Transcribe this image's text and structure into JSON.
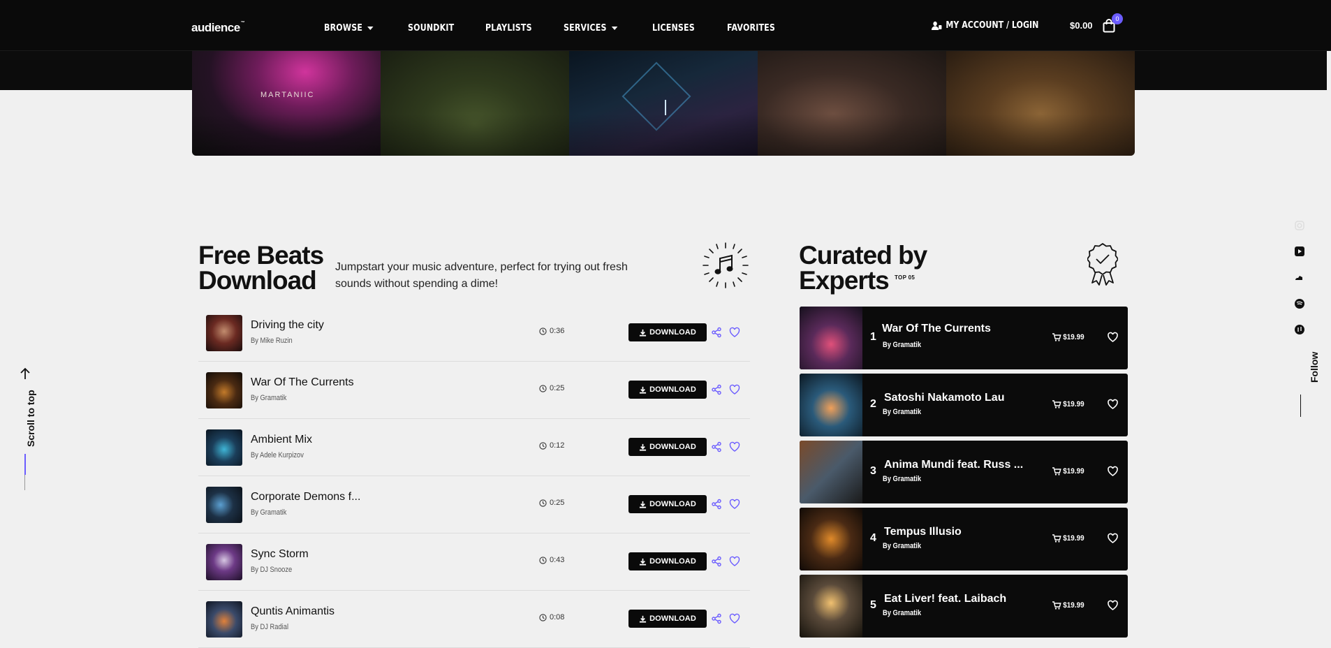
{
  "header": {
    "logo": "audience",
    "logo_tm": "™",
    "nav": [
      "BROWSE",
      "SOUNDKIT",
      "PLAYLISTS",
      "SERVICES",
      "LICENSES",
      "FAVORITES"
    ],
    "account": "MY ACCOUNT / LOGIN",
    "cart_total": "$0.00",
    "cart_count": "0"
  },
  "banner": {
    "label": "MARTANIIC"
  },
  "free_beats": {
    "title_line1": "Free Beats",
    "title_line2": "Download",
    "intro": "Jumpstart your music adventure, perfect for trying out fresh sounds without spending a dime!",
    "download_label": "DOWNLOAD",
    "items": [
      {
        "title": "Driving the city",
        "artist": "By Mike Ruzin",
        "time": "0:36"
      },
      {
        "title": "War Of The Currents",
        "artist": "By Gramatik",
        "time": "0:25"
      },
      {
        "title": "Ambient Mix",
        "artist": "By Adele Kurpizov",
        "time": "0:12"
      },
      {
        "title": "Corporate Demons f...",
        "artist": "By Gramatik",
        "time": "0:25"
      },
      {
        "title": "Sync Storm",
        "artist": "By DJ Snooze",
        "time": "0:43"
      },
      {
        "title": "Quntis Animantis",
        "artist": "By DJ Radial",
        "time": "0:08"
      }
    ]
  },
  "curated": {
    "title_line1": "Curated by",
    "title_line2": "Experts",
    "badge": "TOP 05",
    "items": [
      {
        "num": "1",
        "title": "War Of The Currents",
        "artist": "By Gramatik",
        "price": "$19.99"
      },
      {
        "num": "2",
        "title": "Satoshi Nakamoto Lau",
        "artist": "By Gramatik",
        "price": "$19.99"
      },
      {
        "num": "3",
        "title": "Anima Mundi feat. Russ ...",
        "artist": "By Gramatik",
        "price": "$19.99"
      },
      {
        "num": "4",
        "title": "Tempus Illusio",
        "artist": "By Gramatik",
        "price": "$19.99"
      },
      {
        "num": "5",
        "title": "Eat Liver! feat. Laibach",
        "artist": "By Gramatik",
        "price": "$19.99"
      }
    ]
  },
  "sidebar": {
    "scroll_to_top": "Scroll to top",
    "follow": "Follow"
  },
  "colors": {
    "accent": "#6b5cff",
    "dark": "#0a0a0a",
    "background": "#f0f0f0"
  },
  "icons": [
    "user-icon",
    "bag-icon",
    "clock-icon",
    "download-icon",
    "share-icon",
    "heart-icon",
    "cart-icon",
    "music-note-icon",
    "award-icon",
    "arrow-up-icon",
    "instagram-icon",
    "youtube-icon",
    "soundcloud-icon",
    "spotify-icon",
    "apple-music-icon"
  ]
}
